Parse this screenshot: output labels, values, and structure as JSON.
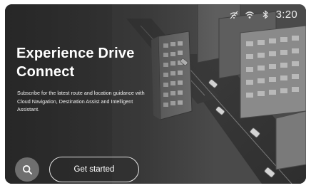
{
  "status_bar": {
    "time": "3:20",
    "icons": [
      "no-signal-icon",
      "wifi-icon",
      "bluetooth-icon"
    ]
  },
  "hero": {
    "title_line1": "Experience Drive",
    "title_line2": "Connect",
    "description": "Subscribe for the latest route and location guidance with Cloud Navigation, Destination Assist and Intelligent Assistant."
  },
  "actions": {
    "search_icon": "search-icon",
    "get_started_label": "Get started"
  }
}
